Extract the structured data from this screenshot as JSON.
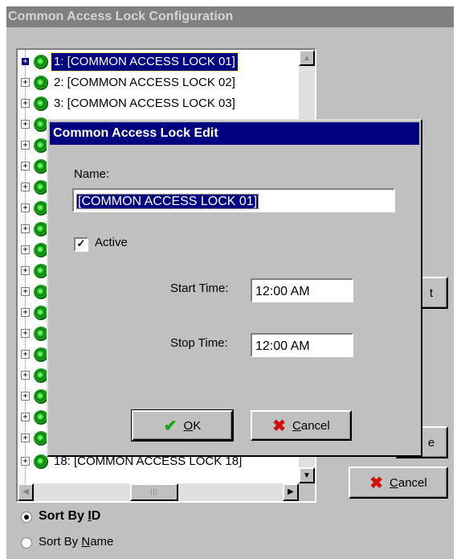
{
  "window": {
    "title": "Common Access Lock Configuration"
  },
  "tree": {
    "items": [
      {
        "label": "1: [COMMON ACCESS LOCK 01]"
      },
      {
        "label": "2: [COMMON ACCESS LOCK 02]"
      },
      {
        "label": "3: [COMMON ACCESS LOCK 03]"
      },
      {
        "label": "18: [COMMON ACCESS LOCK 18]"
      }
    ],
    "expand_glyph": "+"
  },
  "side_buttons": {
    "edit_partial": "t",
    "save_partial": "e",
    "cancel_label": "Cancel",
    "cancel_mnemonic": "C",
    "cancel_rest": "ancel"
  },
  "sort": {
    "by_id_label": "Sort By ",
    "by_id_mnemonic": "I",
    "by_id_rest": "D",
    "by_name_label": "Sort By ",
    "by_name_mnemonic": "N",
    "by_name_rest": "ame",
    "selected": "id"
  },
  "dialog": {
    "title": "Common Access Lock Edit",
    "name_label": "Name:",
    "name_value": "[COMMON ACCESS LOCK 01]",
    "active_label": "Active",
    "active_checked": "✓",
    "start_label": "Start Time:",
    "start_value": "12:00 AM",
    "stop_label": "Stop Time:",
    "stop_value": "12:00 AM",
    "ok_mnemonic": "O",
    "ok_rest": "K",
    "cancel_mnemonic": "C",
    "cancel_rest": "ancel"
  },
  "icons": {
    "check": "✔",
    "x": "✖",
    "up": "▲",
    "down": "▼",
    "left": "◀",
    "right": "▶",
    "grip": "|||"
  },
  "colors": {
    "selection": "#000080",
    "title_inactive": "#808080",
    "lamp": "#1ebd1e",
    "ok_check": "#1aa31a",
    "cancel_x": "#d01010"
  }
}
